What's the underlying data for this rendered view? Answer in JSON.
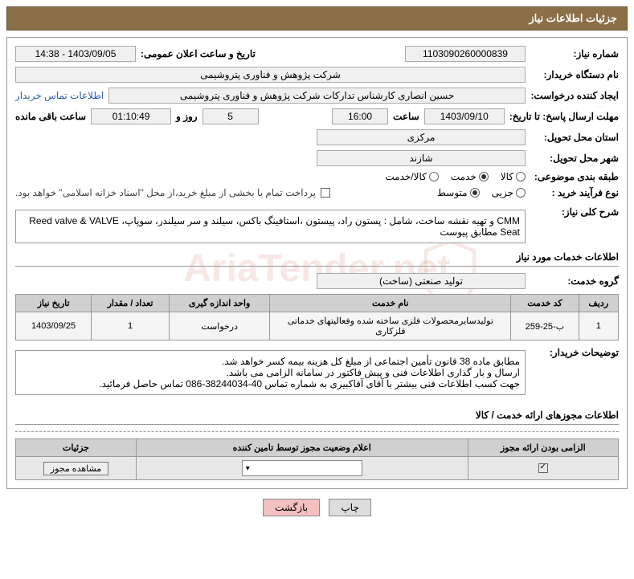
{
  "header": {
    "title": "جزئیات اطلاعات نیاز"
  },
  "fields": {
    "need_number_label": "شماره نیاز:",
    "need_number": "1103090260000839",
    "announce_label": "تاریخ و ساعت اعلان عمومی:",
    "announce_value": "1403/09/05 - 14:38",
    "buyer_org_label": "نام دستگاه خریدار:",
    "buyer_org": "شرکت پژوهش و فناوری پتروشیمی",
    "requester_label": "ایجاد کننده درخواست:",
    "requester": "حسین انصاری کارشناس تدارکات شرکت پژوهش و فناوری پتروشیمی",
    "contact_link": "اطلاعات تماس خریدار",
    "deadline_label": "مهلت ارسال پاسخ: تا تاریخ:",
    "deadline_date": "1403/09/10",
    "time_label": "ساعت",
    "deadline_time": "16:00",
    "days_val": "5",
    "days_label": "روز و",
    "countdown": "01:10:49",
    "remaining_label": "ساعت باقی مانده",
    "province_label": "استان محل تحویل:",
    "province": "مرکزی",
    "city_label": "شهر محل تحویل:",
    "city": "شازند",
    "category_label": "طبقه بندی موضوعی:",
    "cat_goods": "کالا",
    "cat_service": "خدمت",
    "cat_both": "کالا/خدمت",
    "purchase_type_label": "نوع فرآیند خرید :",
    "pt_partial": "جزیی",
    "pt_medium": "متوسط",
    "payment_note": "پرداخت تمام یا بخشی از مبلغ خرید،از محل \"اسناد خزانه اسلامی\" خواهد بود.",
    "overview_label": "شرح کلی نیاز:",
    "overview_text": "CMM و تهیه نقشه ساخت، شامل : پستون راد، پیستون ،استافینگ باکس، سیلند و سر سیلندر، سوپاپ، Reed valve & VALVE Seat مطابق پیوست",
    "services_title": "اطلاعات خدمات مورد نیاز",
    "service_group_label": "گروه خدمت:",
    "service_group": "تولید صنعتی (ساخت)",
    "buyer_notes_label": "توضیحات خریدار:",
    "buyer_notes_l1": "مطابق ماده 38 قانون تأمین اجتماعی از مبلغ کل هزینه بیمه کسر خواهد شد.",
    "buyer_notes_l2": "ارسال و بار گذاری اطلاعات فنی و پیش فاکتور در سامانه الزامی می باشد.",
    "buyer_notes_l3": "جهت کسب اطلاعات فنی بیشتر با آقای آقاکبیری به شماره تماس 40-38244034-086 تماس حاصل فرمائید.",
    "license_title": "اطلاعات مجوزهای ارائه خدمت / کالا"
  },
  "service_table": {
    "headers": {
      "row": "ردیف",
      "code": "کد خدمت",
      "name": "نام خدمت",
      "unit": "واحد اندازه گیری",
      "qty": "تعداد / مقدار",
      "date": "تاریخ نیاز"
    },
    "rows": [
      {
        "row": "1",
        "code": "ب-25-259",
        "name": "تولیدسایرمحصولات فلزی ساخته شده وفعالیتهای خدماتی فلزکاری",
        "unit": "درخواست",
        "qty": "1",
        "date": "1403/09/25"
      }
    ]
  },
  "license_table": {
    "headers": {
      "mandatory": "الزامی بودن ارائه مجوز",
      "status": "اعلام وضعیت مجوز توسط تامین کننده",
      "details": "جزئیات"
    },
    "view_btn": "مشاهده مجوز"
  },
  "buttons": {
    "print": "چاپ",
    "back": "بازگشت"
  }
}
